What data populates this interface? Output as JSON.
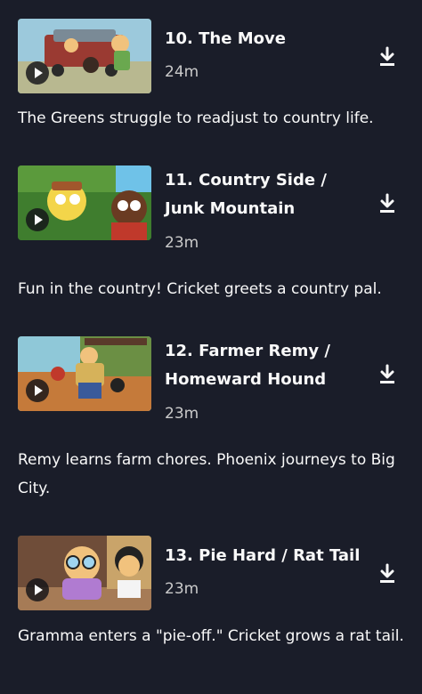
{
  "episodes": [
    {
      "title": "10. The Move",
      "duration": "24m",
      "description": "The Greens struggle to readjust to country life."
    },
    {
      "title": "11. Country Side / Junk Mountain",
      "duration": "23m",
      "description": "Fun in the country! Cricket greets a country pal."
    },
    {
      "title": "12. Farmer Remy / Homeward Hound",
      "duration": "23m",
      "description": "Remy learns farm chores. Phoenix journeys to Big City."
    },
    {
      "title": "13. Pie Hard / Rat Tail",
      "duration": "23m",
      "description": "Gramma enters a \"pie-off.\" Cricket grows a rat tail."
    }
  ],
  "icons": {
    "play": "play-icon",
    "download": "download-icon"
  },
  "colors": {
    "background": "#1a1d29",
    "text": "#f9f9f9",
    "muted": "#cacaca"
  }
}
